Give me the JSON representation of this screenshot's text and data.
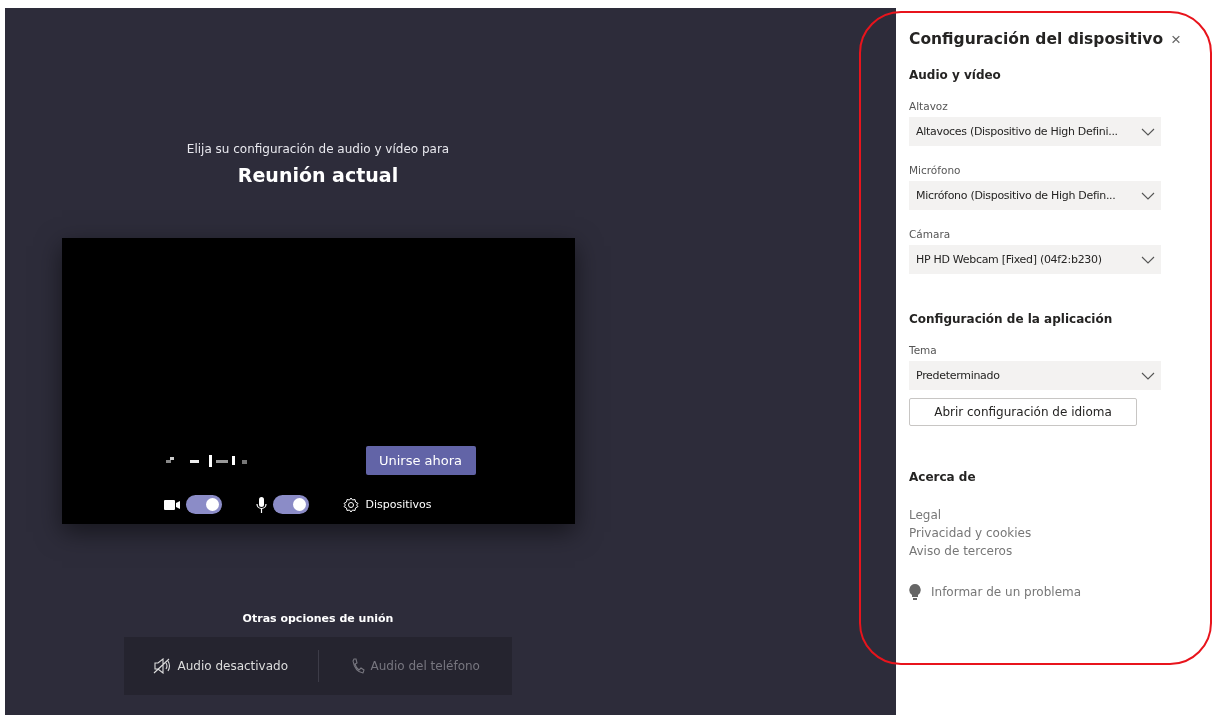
{
  "prejoin": {
    "prompt": "Elija su configuración de audio y vídeo para",
    "meeting_title": "Reunión actual",
    "join_button": "Unirse ahora",
    "toggles": [
      {
        "kind": "camera",
        "on": true
      },
      {
        "kind": "microphone",
        "on": true
      }
    ],
    "devices_button": "Dispositivos",
    "other_options": {
      "heading": "Otras opciones de unión",
      "options": [
        {
          "kind": "audio-off",
          "label": "Audio desactivado",
          "disabled": false
        },
        {
          "kind": "phone",
          "label": "Audio del teléfono",
          "disabled": true
        }
      ]
    }
  },
  "panel": {
    "title": "Configuración del dispositivo",
    "close": "×",
    "audio_video": {
      "heading": "Audio y vídeo",
      "fields": [
        {
          "label": "Altavoz",
          "value": "Altavoces (Dispositivo de High Defini..."
        },
        {
          "label": "Micrófono",
          "value": "Micrófono (Dispositivo de High Defin..."
        },
        {
          "label": "Cámara",
          "value": "HP HD Webcam [Fixed] (04f2:b230)"
        }
      ]
    },
    "app_settings": {
      "heading": "Configuración de la aplicación",
      "fields": [
        {
          "label": "Tema",
          "value": "Predeterminado"
        }
      ],
      "language_button": "Abrir configuración de idioma"
    },
    "about": {
      "heading": "Acerca de",
      "links": [
        "Legal",
        "Privacidad y cookies",
        "Aviso de terceros"
      ]
    },
    "report": "Informar de un problema"
  },
  "annotation": {
    "kind": "ring",
    "color": "#e8141c"
  }
}
